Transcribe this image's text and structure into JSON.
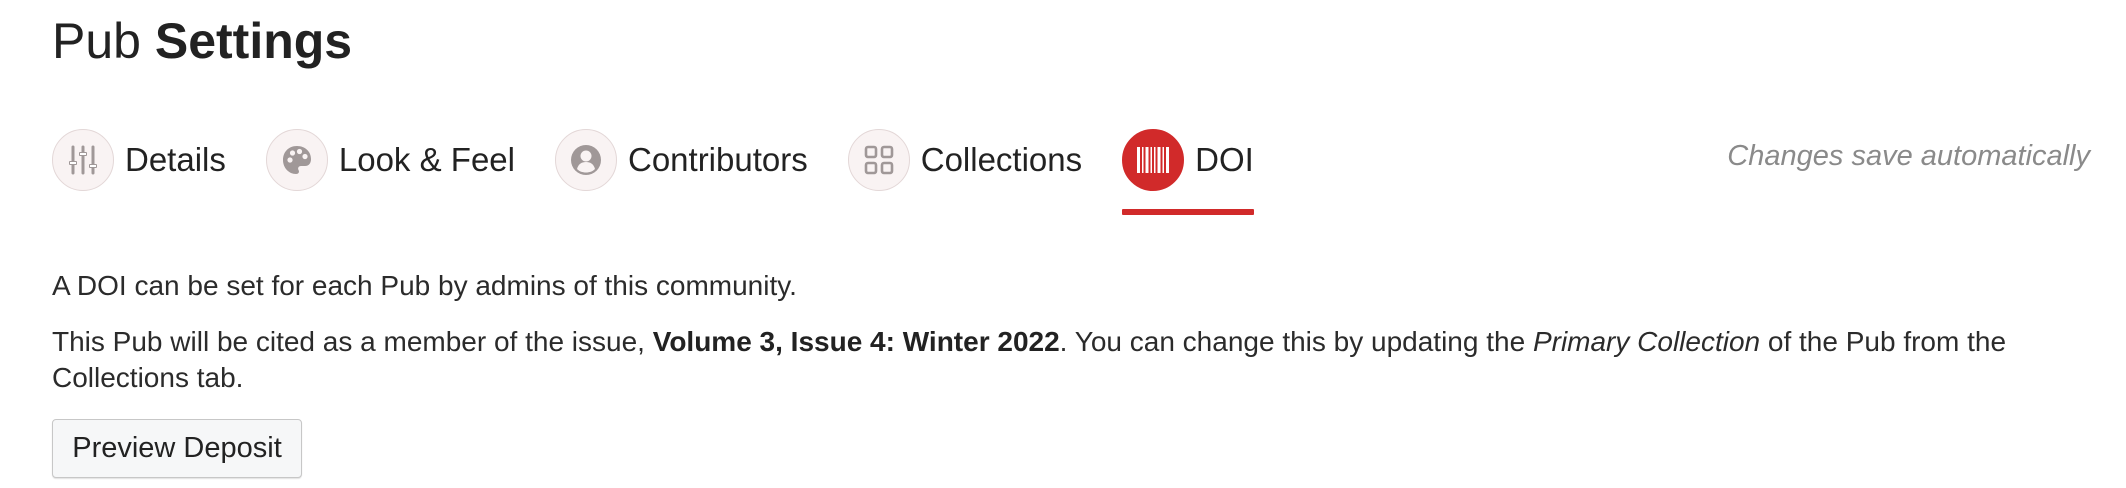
{
  "header": {
    "title_light": "Pub",
    "title_bold": "Settings"
  },
  "tabs": [
    {
      "label": "Details",
      "icon": "sliders-icon",
      "active": false
    },
    {
      "label": "Look & Feel",
      "icon": "palette-icon",
      "active": false
    },
    {
      "label": "Contributors",
      "icon": "person-icon",
      "active": false
    },
    {
      "label": "Collections",
      "icon": "grid-icon",
      "active": false
    },
    {
      "label": "DOI",
      "icon": "barcode-icon",
      "active": true
    }
  ],
  "status": {
    "autosave": "Changes save automatically"
  },
  "content": {
    "intro": "A DOI can be set for each Pub by admins of this community.",
    "cite_pre": "This Pub will be cited as a member of the issue, ",
    "cite_issue": "Volume 3, Issue 4: Winter 2022",
    "cite_mid": ". You can change this by updating the ",
    "cite_em": "Primary Collection",
    "cite_post": " of the Pub from the Collections tab."
  },
  "actions": {
    "preview_label": "Preview Deposit"
  },
  "colors": {
    "accent": "#d12a2a",
    "icon_gray": "#a09898",
    "muted_text": "#8a8a8a"
  }
}
